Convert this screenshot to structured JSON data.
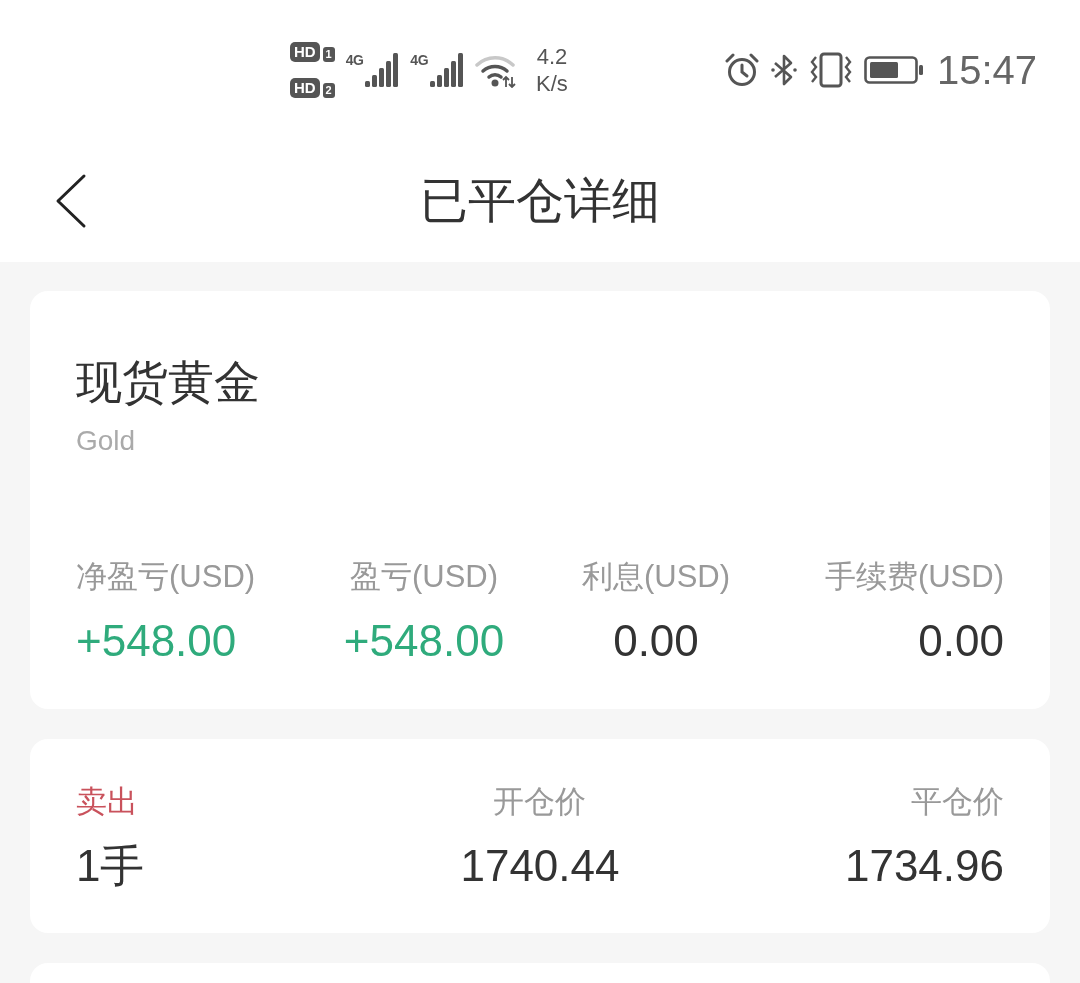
{
  "status_bar": {
    "sims": [
      {
        "badge": "HD",
        "slot": "1"
      },
      {
        "badge": "HD",
        "slot": "2"
      }
    ],
    "networks": [
      {
        "type": "4G"
      },
      {
        "type": "4G"
      }
    ],
    "speed": {
      "value": "4.2",
      "unit": "K/s"
    },
    "time": "15:47"
  },
  "header": {
    "title": "已平仓详细"
  },
  "instrument": {
    "name": "现货黄金",
    "symbol": "Gold"
  },
  "summary": [
    {
      "label": "净盈亏(USD)",
      "value": "+548.00",
      "color": "#2fab7c"
    },
    {
      "label": "盈亏(USD)",
      "value": "+548.00",
      "color": "#2fab7c"
    },
    {
      "label": "利息(USD)",
      "value": "0.00",
      "color": "#333333"
    },
    {
      "label": "手续费(USD)",
      "value": "0.00",
      "color": "#333333"
    }
  ],
  "position": [
    {
      "kind": "side",
      "label": "卖出",
      "color": "#c9525c",
      "value": "1手"
    },
    {
      "kind": "price",
      "label": "开仓价",
      "value": "1740.44"
    },
    {
      "kind": "price",
      "label": "平仓价",
      "value": "1734.96"
    }
  ]
}
